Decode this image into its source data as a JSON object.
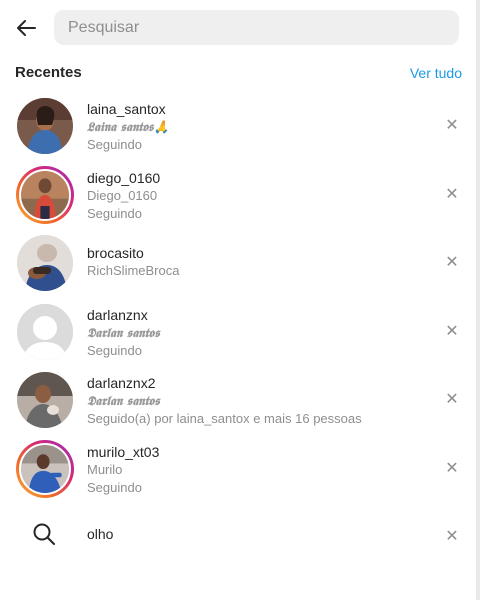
{
  "search": {
    "placeholder": "Pesquisar",
    "value": ""
  },
  "recents": {
    "title": "Recentes",
    "see_all": "Ver tudo",
    "users": [
      {
        "username": "laina_santox",
        "name": "𝕷𝖆𝖎𝖓𝖆 𝖘𝖆𝖓𝖙𝖔𝖘🙏",
        "status": "Seguindo",
        "story_ring": false
      },
      {
        "username": "diego_0160",
        "name": "Diego_0160",
        "status": "Seguindo",
        "story_ring": true
      },
      {
        "username": "brocasito",
        "name": "RichSlimeBroca",
        "status": "",
        "story_ring": false
      },
      {
        "username": "darlanznx",
        "name": "𝕯𝖆𝖗𝖑𝖆𝖓 𝖘𝖆𝖓𝖙𝖔𝖘",
        "status": "Seguindo",
        "story_ring": false
      },
      {
        "username": "darlanznx2",
        "name": "𝕯𝖆𝖗𝖑𝖆𝖓 𝖘𝖆𝖓𝖙𝖔𝖘",
        "status": "Seguido(a) por laina_santox e mais 16 pessoas",
        "story_ring": false
      },
      {
        "username": "murilo_xt03",
        "name": "Murilo",
        "status": "Seguindo",
        "story_ring": true
      }
    ],
    "query": "olho"
  },
  "icons": {
    "back": "arrow-left-icon",
    "close": "close-icon",
    "search": "search-icon"
  }
}
